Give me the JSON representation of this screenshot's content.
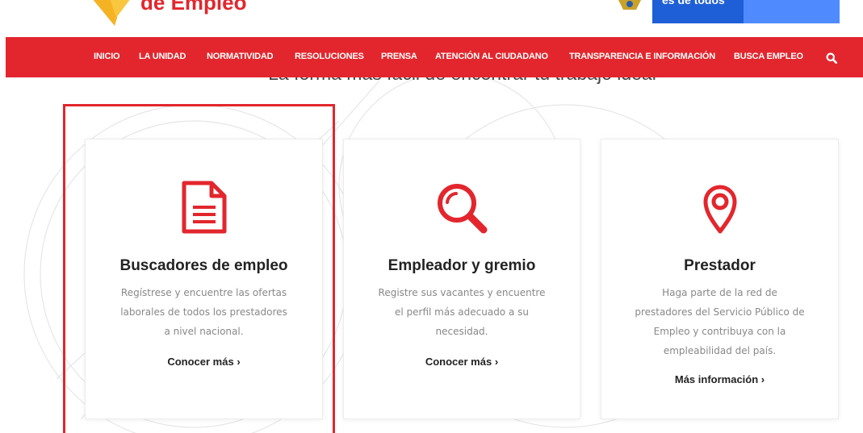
{
  "header": {
    "logo_text": "de Empleo",
    "gov_banner_text": "es de todos"
  },
  "nav": {
    "items": [
      "INICIO",
      "LA UNIDAD",
      "NORMATIVIDAD",
      "RESOLUCIONES",
      "PRENSA",
      "ATENCIÓN AL CIUDADANO",
      "TRANSPARENCIA E INFORMACIÓN",
      "BUSCA EMPLEO"
    ],
    "search_icon": "search-icon"
  },
  "tagline": "La forma más fácil de encontrar tu trabajo ideal",
  "cards": [
    {
      "icon": "document-icon",
      "title": "Buscadores de empleo",
      "desc_lines": [
        "Regístrese y encuentre las ofertas",
        "laborales de todos los prestadores",
        "a nivel nacional."
      ],
      "link": "Conocer más ›"
    },
    {
      "icon": "magnifier-icon",
      "title": "Empleador y gremio",
      "desc_lines": [
        "Registre sus vacantes y encuentre",
        "el perfil más adecuado a su",
        "necesidad."
      ],
      "link": "Conocer más ›"
    },
    {
      "icon": "map-pin-icon",
      "title": "Prestador",
      "desc_lines": [
        "Haga parte de la red de",
        "prestadores del Servicio Público de",
        "Empleo y contribuya con la",
        "empleabilidad del país."
      ],
      "link": "Más información ›"
    }
  ],
  "colors": {
    "brand_red": "#e3262d",
    "gov_blue": "#1e5fd8"
  }
}
